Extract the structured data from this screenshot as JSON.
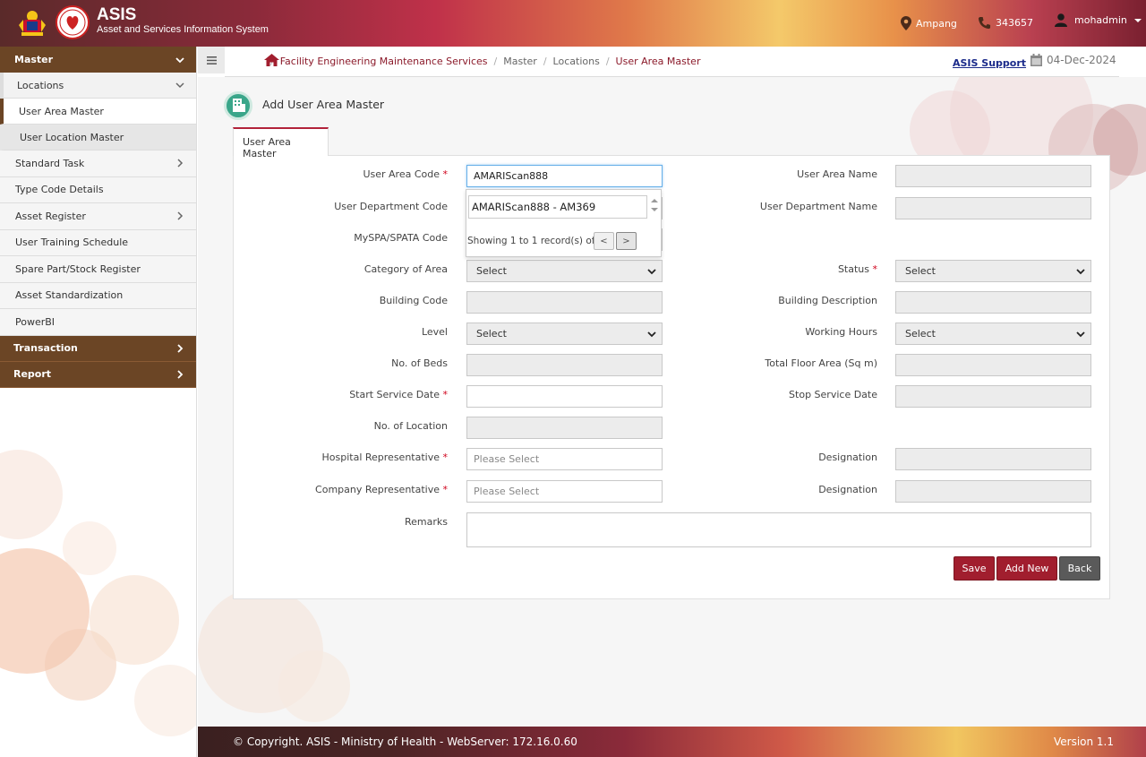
{
  "header": {
    "title": "ASIS",
    "subtitle": "Asset and Services Information System",
    "location": "Ampang",
    "phone": "343657",
    "user": "mohadmin"
  },
  "sidebar": {
    "master": "Master",
    "locations": "Locations",
    "location_items": [
      "User Area Master",
      "User Location Master"
    ],
    "items": [
      "Standard Task",
      "Type Code Details",
      "Asset Register",
      "User Training Schedule",
      "Spare Part/Stock Register",
      "Asset Standardization",
      "PowerBI"
    ],
    "transaction": "Transaction",
    "report": "Report"
  },
  "breadcrumb": {
    "items": [
      "Facility Engineering Maintenance Services",
      "Master",
      "Locations",
      "User Area Master"
    ]
  },
  "topbar": {
    "support": "ASIS Support",
    "date": "04-Dec-2024"
  },
  "page": {
    "title": "Add User Area Master",
    "tab": "User Area Master"
  },
  "form": {
    "user_area_code_label": "User Area Code",
    "user_area_code_value": "AMARIScan888",
    "user_area_name_label": "User Area Name",
    "user_dept_code_label": "User Department Code",
    "user_dept_name_label": "User Department Name",
    "myspa_label": "MySPA/SPATA Code",
    "category_label": "Category of Area",
    "category_value": "Select",
    "status_label": "Status",
    "status_value": "Select",
    "building_code_label": "Building Code",
    "building_desc_label": "Building Description",
    "level_label": "Level",
    "level_value": "Select",
    "working_hours_label": "Working Hours",
    "working_hours_value": "Select",
    "beds_label": "No. of Beds",
    "floor_area_label": "Total Floor Area (Sq m)",
    "start_date_label": "Start Service Date",
    "stop_date_label": "Stop Service Date",
    "num_location_label": "No. of Location",
    "hospital_rep_label": "Hospital Representative",
    "hospital_rep_placeholder": "Please Select",
    "designation_label": "Designation",
    "company_rep_label": "Company Representative",
    "company_rep_placeholder": "Please Select",
    "designation2_label": "Designation",
    "remarks_label": "Remarks"
  },
  "autocomplete": {
    "item": "AMARIScan888 - AM369",
    "info": "Showing 1 to 1 record(s) of 1",
    "prev": "<",
    "next": ">"
  },
  "buttons": {
    "save": "Save",
    "add_new": "Add New",
    "back": "Back"
  },
  "footer": {
    "copyright": "© Copyright. ASIS - Ministry of Health - WebServer: 172.16.0.60",
    "version": "Version 1.1"
  },
  "colors": {
    "accent": "#a11e2e",
    "sidebar_header": "#6b4525"
  }
}
